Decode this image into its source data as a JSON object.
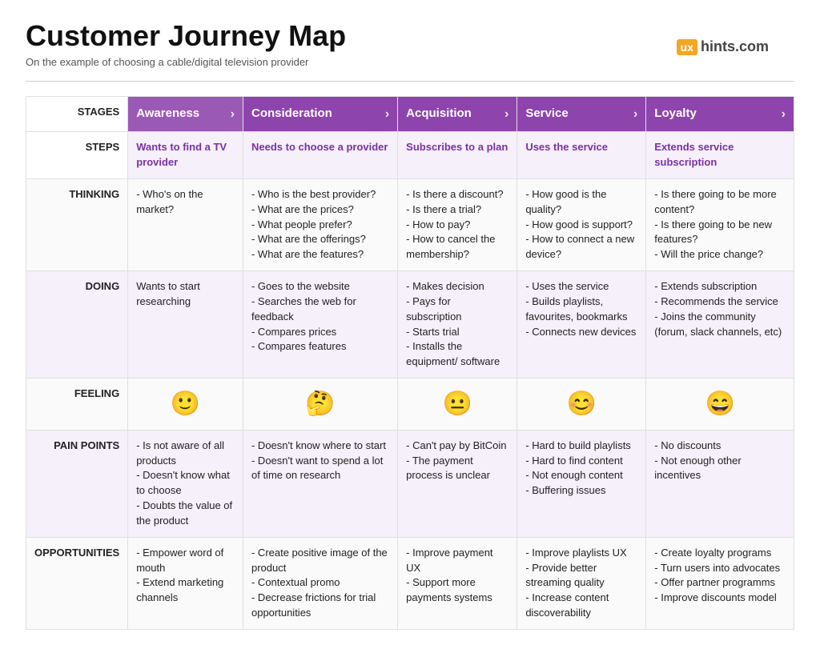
{
  "header": {
    "title": "Customer Journey Map",
    "subtitle": "On the example of choosing a cable/digital television provider",
    "logo_ux": "ux",
    "logo_domain": "hints.com"
  },
  "row_labels": {
    "stages": "STAGES",
    "steps": "STEPS",
    "thinking": "THINKING",
    "doing": "DOING",
    "feeling": "FEELING",
    "pain_points": "PAIN POINTS",
    "opportunities": "OPPORTUNITIES"
  },
  "stages": [
    {
      "name": "Awareness",
      "color": "#9b59b6",
      "step": "Wants to find a TV provider",
      "thinking": "- Who's on the market?",
      "doing": "Wants to start researching",
      "feeling_emoji": "🙂",
      "pain_points": "- Is not aware of all products\n- Doesn't know what to choose\n- Doubts the value of the product",
      "opportunities": "- Empower word of mouth\n- Extend marketing channels"
    },
    {
      "name": "Consideration",
      "color": "#8e44ad",
      "step": "Needs to choose a provider",
      "thinking": "- Who is the best provider?\n- What are the prices?\n- What people prefer?\n- What are the offerings?\n- What are the features?",
      "doing": "- Goes to the website\n- Searches the web for feedback\n- Compares prices\n- Compares features",
      "feeling_emoji": "🤔",
      "pain_points": "- Doesn't know where to start\n- Doesn't want to spend a lot of time on research",
      "opportunities": "- Create positive image of the product\n- Contextual promo\n- Decrease frictions for trial opportunities"
    },
    {
      "name": "Acquisition",
      "color": "#8e44ad",
      "step": "Subscribes to a plan",
      "thinking": "- Is there a discount?\n- Is there a trial?\n- How to pay?\n- How to cancel the membership?",
      "doing": "- Makes decision\n- Pays for subscription\n- Starts trial\n- Installs the equipment/ software",
      "feeling_emoji": "😐",
      "pain_points": "- Can't pay by BitCoin\n- The payment process is unclear",
      "opportunities": "- Improve payment UX\n- Support more payments systems"
    },
    {
      "name": "Service",
      "color": "#8e44ad",
      "step": "Uses the service",
      "thinking": "- How good is the quality?\n- How good is support?\n- How to connect a new device?",
      "doing": "- Uses the service\n- Builds playlists, favourites, bookmarks\n- Connects new devices",
      "feeling_emoji": "😊",
      "pain_points": "- Hard to build playlists\n- Hard to find content\n- Not enough content\n- Buffering issues",
      "opportunities": "- Improve playlists UX\n- Provide better streaming quality\n- Increase content discoverability"
    },
    {
      "name": "Loyalty",
      "color": "#8e44ad",
      "step": "Extends  service subscription",
      "thinking": "- Is there going to be more content?\n- Is there going to be new features?\n- Will the price change?",
      "doing": "- Extends subscription\n- Recommends the service\n- Joins the community (forum, slack channels, etc)",
      "feeling_emoji": "😄",
      "pain_points": "- No discounts\n- Not enough other incentives",
      "opportunities": "- Create loyalty programs\n- Turn users into advocates\n- Offer partner programms\n- Improve discounts model"
    }
  ]
}
